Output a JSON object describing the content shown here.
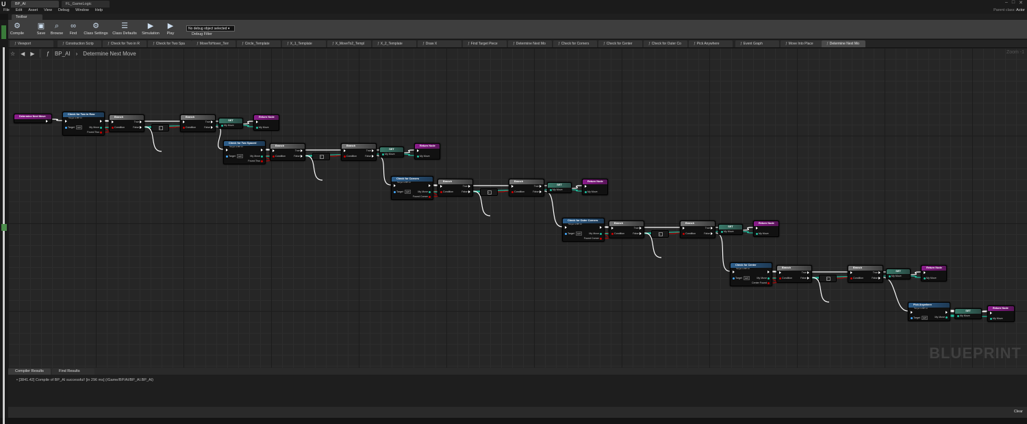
{
  "window": {
    "tabs": [
      "BP_AI",
      "FL_GameLogic"
    ],
    "active_tab": 0,
    "parent_class_label": "Parent class:",
    "parent_class_value": "Actor"
  },
  "menu": [
    "File",
    "Edit",
    "Asset",
    "View",
    "Debug",
    "Window",
    "Help"
  ],
  "toolbar": {
    "tab_label": "Toolbar",
    "buttons": [
      {
        "label": "Compile",
        "icon": "gear-icon"
      },
      {
        "label": "Save",
        "icon": "floppy-icon"
      },
      {
        "label": "Browse",
        "icon": "magnifier-icon"
      },
      {
        "label": "Find",
        "icon": "binoculars-icon"
      },
      {
        "label": "Class Settings",
        "icon": "settings-icon"
      },
      {
        "label": "Class Defaults",
        "icon": "defaults-icon"
      },
      {
        "label": "Simulation",
        "icon": "simulate-icon"
      },
      {
        "label": "Play",
        "icon": "play-icon"
      }
    ],
    "debug_select": "No debug object selected",
    "debug_label": "Debug Filter"
  },
  "graph_tabs": [
    "Viewport",
    "Construction Scrip",
    "Check for Two in R",
    "Check for Two Spa",
    "MoveToHover_Terr",
    "Circle_Template",
    "X_1_Template",
    "X_MoveTo2_Templ",
    "X_2_Template",
    "Draw X",
    "Find Target Piece",
    "Determine Next Mo",
    "Check for Corners",
    "Check for Center",
    "Check for Outer Co",
    "Pick Anywhere",
    "Event Graph",
    "Move Into Place",
    "Determine Next Mo"
  ],
  "active_graph_tab": 18,
  "breadcrumb": {
    "blueprint": "BP_AI",
    "function": "Determine Next Move"
  },
  "zoom": "Zoom -1",
  "watermark": "BLUEPRINT",
  "graph": {
    "entry": {
      "title": "Determine Next Move"
    },
    "return_title": "Return Node",
    "branch_title": "Branch",
    "set_title": "SET",
    "target_label": "Target",
    "self_label": "self",
    "target_sub": "Target is BP AI",
    "pin_condition": "Condition",
    "pin_true": "True",
    "pin_false": "False",
    "pin_my_move": "My Move",
    "checks": [
      {
        "title": "Check for Two in Row",
        "found": "Found Two"
      },
      {
        "title": "Check for Two Spaced",
        "found": "Found Two"
      },
      {
        "title": "Check for Corners",
        "found": "Found Corner"
      },
      {
        "title": "Check for Outer Corners",
        "found": "Found Corner"
      },
      {
        "title": "Check for Center",
        "found": "Center Found"
      },
      {
        "title": "Pick Anywhere",
        "found": ""
      }
    ]
  },
  "bottom": {
    "tabs": [
      "Compiler Results",
      "Find Results"
    ],
    "log_line": "• [3841.42] Compile of BP_AI successful! [in 296 ms] (/Game/BP/AI/BP_AI.BP_AI)",
    "clear_label": "Clear"
  },
  "colors": {
    "exec": "#ffffff",
    "bool": "#c00000",
    "struct": "#20c0a0",
    "object": "#44aaff"
  }
}
